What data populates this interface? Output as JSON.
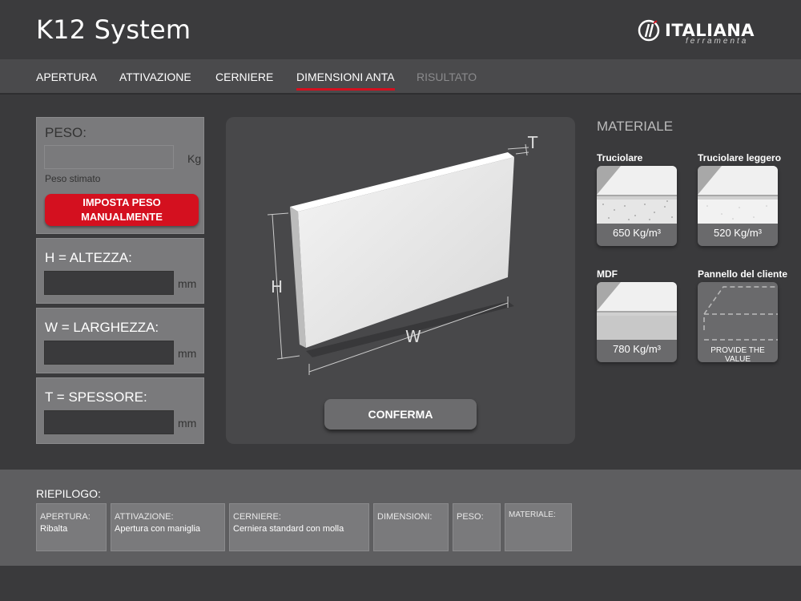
{
  "header": {
    "title": "K12 System",
    "logo_name": "ITALIANA",
    "logo_sub": "ferramenta"
  },
  "nav": {
    "tabs": [
      {
        "label": "APERTURA",
        "state": "normal"
      },
      {
        "label": "ATTIVAZIONE",
        "state": "normal"
      },
      {
        "label": "CERNIERE",
        "state": "normal"
      },
      {
        "label": "DIMENSIONI ANTA",
        "state": "active"
      },
      {
        "label": "RISULTATO",
        "state": "disabled"
      }
    ]
  },
  "weight": {
    "label": "PESO:",
    "value": "",
    "unit": "Kg",
    "note": "Peso stimato",
    "button_line1": "IMPOSTA PESO",
    "button_line2": "MANUALMENTE"
  },
  "height": {
    "label": "H = ALTEZZA:",
    "value": "",
    "unit": "mm"
  },
  "width": {
    "label": "W = LARGHEZZA:",
    "value": "",
    "unit": "mm"
  },
  "thickness": {
    "label": "T = SPESSORE:",
    "value": "",
    "unit": "mm"
  },
  "diagram": {
    "h_label": "H",
    "w_label": "W",
    "t_label": "T",
    "confirm_label": "CONFERMA"
  },
  "materials": {
    "title": "MATERIALE",
    "items": [
      {
        "name": "Truciolare",
        "value": "650 Kg/m³"
      },
      {
        "name": "Truciolare leggero",
        "value": "520 Kg/m³"
      },
      {
        "name": "MDF",
        "value": "780 Kg/m³"
      },
      {
        "name": "Pannello del cliente",
        "value": "PROVIDE THE VALUE"
      }
    ]
  },
  "summary": {
    "title": "RIEPILOGO:",
    "items": [
      {
        "label": "APERTURA:",
        "value": "Ribalta"
      },
      {
        "label": "ATTIVAZIONE:",
        "value": "Apertura con maniglia"
      },
      {
        "label": "CERNIERE:",
        "value": "Cerniera standard con molla"
      },
      {
        "label": "DIMENSIONI:",
        "value": ""
      },
      {
        "label": "PESO:",
        "value": ""
      },
      {
        "label": "MATERIALE:",
        "value": ""
      }
    ]
  },
  "colors": {
    "accent": "#d4101f",
    "background": "#3a3a3c",
    "panel": "#7a7a7c"
  }
}
